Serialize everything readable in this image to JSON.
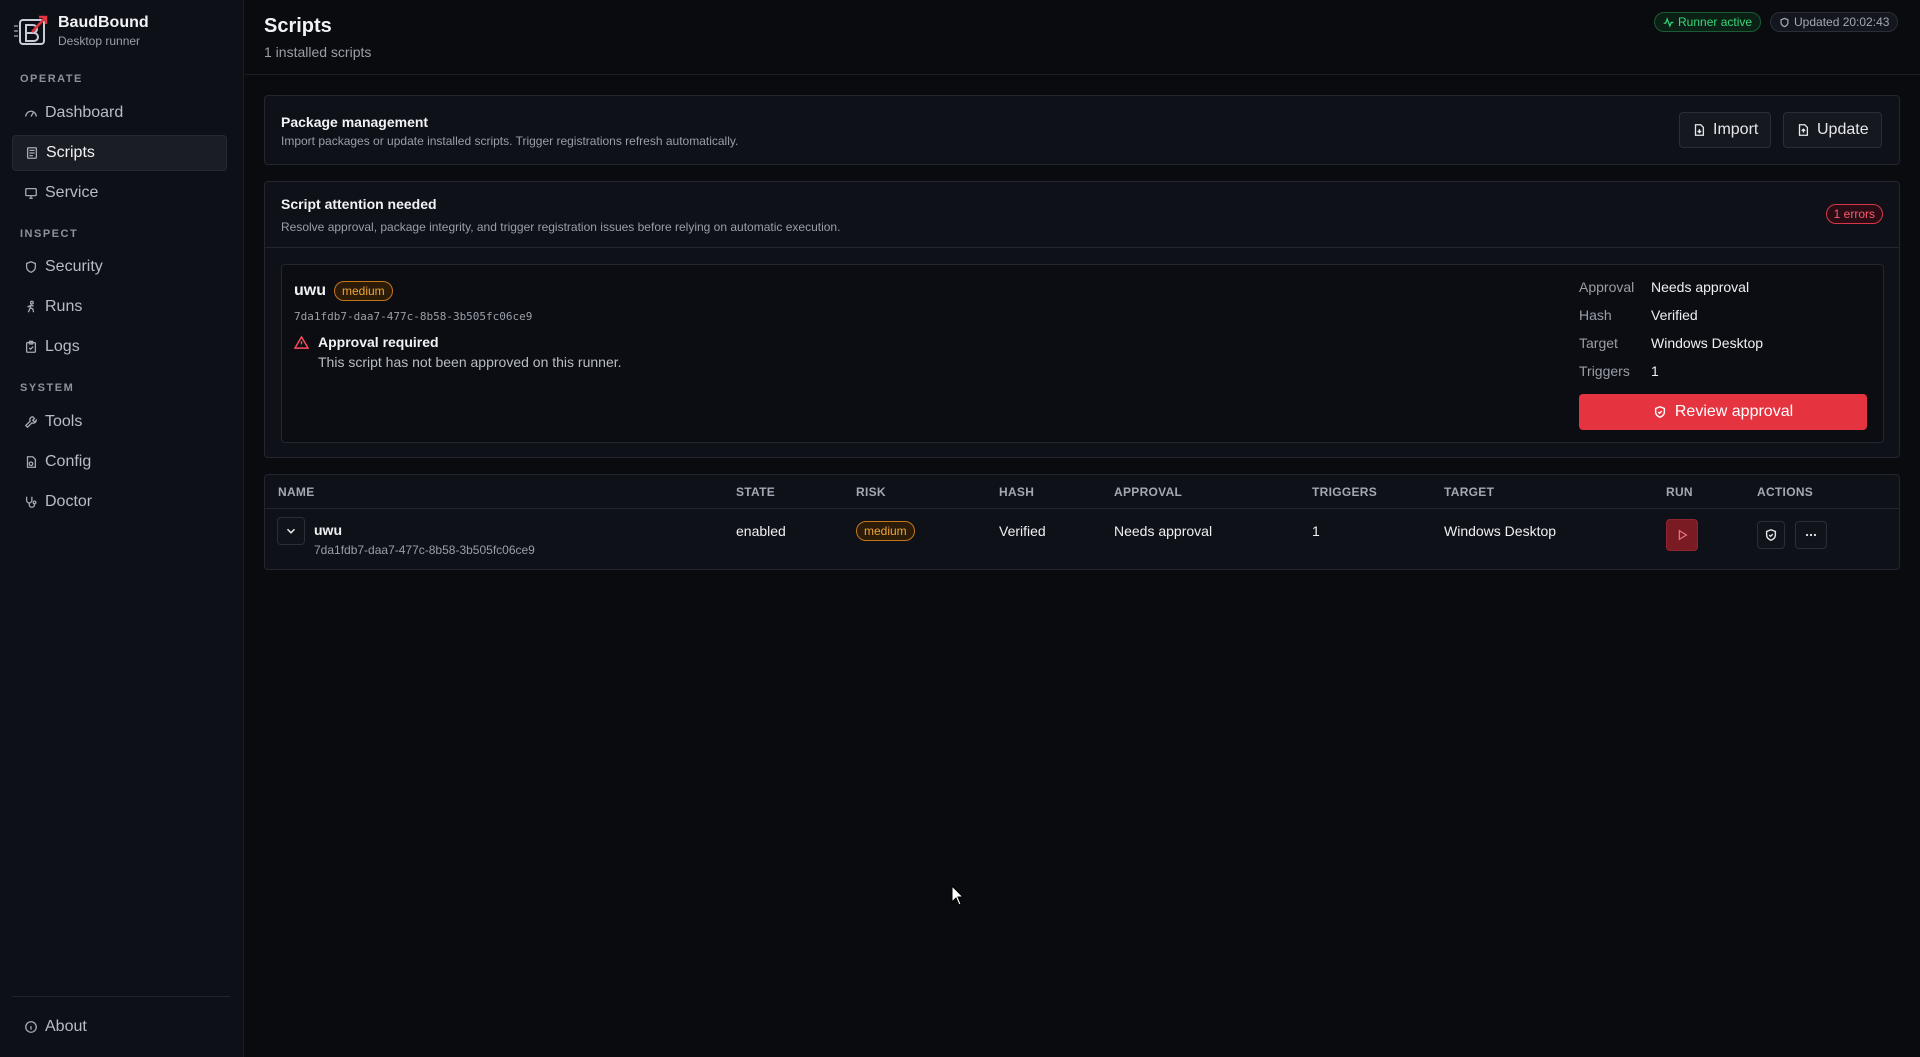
{
  "brand": {
    "name": "BaudBound",
    "subtitle": "Desktop runner"
  },
  "sidebar": {
    "sections": {
      "operate": "OPERATE",
      "inspect": "INSPECT",
      "system": "SYSTEM"
    },
    "items": [
      {
        "label": "Dashboard",
        "icon": "gauge-icon"
      },
      {
        "label": "Scripts",
        "icon": "scroll-icon",
        "active": true
      },
      {
        "label": "Service",
        "icon": "monitor-icon"
      },
      {
        "label": "Security",
        "icon": "shield-icon"
      },
      {
        "label": "Runs",
        "icon": "run-icon"
      },
      {
        "label": "Logs",
        "icon": "clipboard-icon"
      },
      {
        "label": "Tools",
        "icon": "wrench-icon"
      },
      {
        "label": "Config",
        "icon": "file-cog-icon"
      },
      {
        "label": "Doctor",
        "icon": "stethoscope-icon"
      }
    ],
    "about": "About"
  },
  "header": {
    "title": "Scripts",
    "subtitle": "1 installed scripts",
    "runner_status": "Runner active",
    "updated": "Updated 20:02:43"
  },
  "package_card": {
    "title": "Package management",
    "description": "Import packages or update installed scripts. Trigger registrations refresh automatically.",
    "import_label": "Import",
    "update_label": "Update"
  },
  "attention_card": {
    "title": "Script attention needed",
    "description": "Resolve approval, package integrity, and trigger registration issues before relying on automatic execution.",
    "error_badge": "1 errors",
    "script": {
      "name": "uwu",
      "risk": "medium",
      "id": "7da1fdb7-daa7-477c-8b58-3b505fc06ce9",
      "alert_title": "Approval required",
      "alert_text": "This script has not been approved on this runner.",
      "details": {
        "approval_label": "Approval",
        "approval_value": "Needs approval",
        "hash_label": "Hash",
        "hash_value": "Verified",
        "target_label": "Target",
        "target_value": "Windows Desktop",
        "triggers_label": "Triggers",
        "triggers_value": "1"
      },
      "review_label": "Review approval"
    }
  },
  "table": {
    "headers": {
      "name": "NAME",
      "state": "STATE",
      "risk": "RISK",
      "hash": "HASH",
      "approval": "APPROVAL",
      "triggers": "TRIGGERS",
      "target": "TARGET",
      "run": "RUN",
      "actions": "ACTIONS"
    },
    "rows": [
      {
        "name": "uwu",
        "id": "7da1fdb7-daa7-477c-8b58-3b505fc06ce9",
        "state": "enabled",
        "risk": "medium",
        "hash": "Verified",
        "approval": "Needs approval",
        "triggers": "1",
        "target": "Windows Desktop"
      }
    ]
  },
  "colors": {
    "background": "#0a0b0f",
    "accent_red": "#e5333f",
    "success_green": "#37d67a",
    "warning_orange": "#f0a53a"
  }
}
